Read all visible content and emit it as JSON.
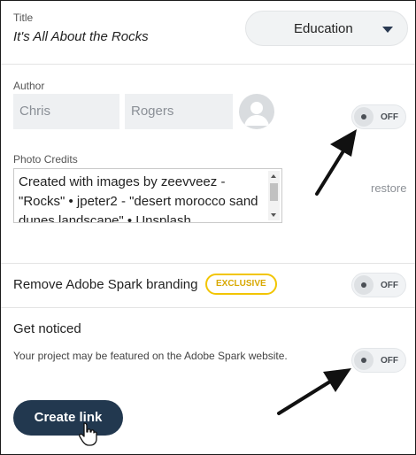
{
  "title_section": {
    "label": "Title",
    "value": "It's All About the Rocks",
    "category_dropdown": {
      "selected": "Education",
      "icon": "caret-down-icon"
    }
  },
  "author_section": {
    "label": "Author",
    "first_name": "Chris",
    "last_name": "Rogers",
    "avatar_icon": "user-avatar-icon",
    "toggle": {
      "state_label": "OFF",
      "on": false
    }
  },
  "photo_credits": {
    "label": "Photo Credits",
    "text": "Created with images by zeevveez - \"Rocks\" • jpeter2 - \"desert morocco sand dunes landscape\" • Unsplash",
    "restore_label": "restore"
  },
  "branding": {
    "label": "Remove Adobe Spark branding",
    "badge": "EXCLUSIVE",
    "toggle": {
      "state_label": "OFF",
      "on": false
    }
  },
  "get_noticed": {
    "label": "Get noticed",
    "description": "Your project may be featured on the Adobe Spark website.",
    "toggle": {
      "state_label": "OFF",
      "on": false
    }
  },
  "create_link": {
    "label": "Create link",
    "cursor_icon": "hand-pointer-icon"
  },
  "annotations": {
    "arrow_color": "#111111",
    "icon": "arrow-icon"
  },
  "colors": {
    "primary_button": "#22384f",
    "badge_border": "#f2c500",
    "badge_text": "#d8a800",
    "field_background": "#eef0f2"
  }
}
